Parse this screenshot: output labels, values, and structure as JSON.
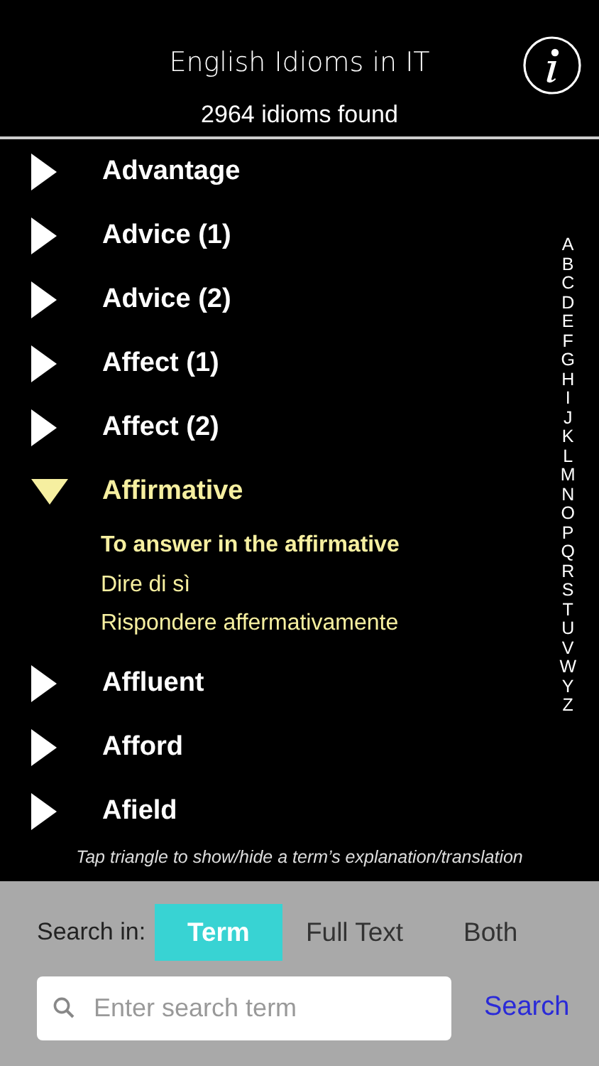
{
  "header": {
    "title": "English Idioms in IT",
    "count": "2964 idioms found"
  },
  "terms": [
    {
      "label": "Advantage",
      "expanded": false
    },
    {
      "label": "Advice (1)",
      "expanded": false
    },
    {
      "label": "Advice (2)",
      "expanded": false
    },
    {
      "label": "Affect (1)",
      "expanded": false
    },
    {
      "label": "Affect (2)",
      "expanded": false
    },
    {
      "label": "Affirmative",
      "expanded": true,
      "children": [
        {
          "kind": "idiom",
          "text": "To answer in the affirmative"
        },
        {
          "kind": "translation",
          "text": "Dire di sì"
        },
        {
          "kind": "translation",
          "text": "Rispondere affermativamente"
        }
      ]
    },
    {
      "label": "Affluent",
      "expanded": false
    },
    {
      "label": "Afford",
      "expanded": false
    },
    {
      "label": "Afield",
      "expanded": false
    }
  ],
  "index": [
    "A",
    "B",
    "C",
    "D",
    "E",
    "F",
    "G",
    "H",
    "I",
    "J",
    "K",
    "L",
    "M",
    "N",
    "O",
    "P",
    "Q",
    "R",
    "S",
    "T",
    "U",
    "V",
    "W",
    "Y",
    "Z"
  ],
  "hint": "Tap triangle to show/hide a term’s explanation/translation",
  "search": {
    "label": "Search in:",
    "scopes": [
      {
        "label": "Term",
        "selected": true
      },
      {
        "label": "Full Text",
        "selected": false
      },
      {
        "label": "Both",
        "selected": false
      }
    ],
    "placeholder": "Enter search term",
    "button": "Search"
  }
}
